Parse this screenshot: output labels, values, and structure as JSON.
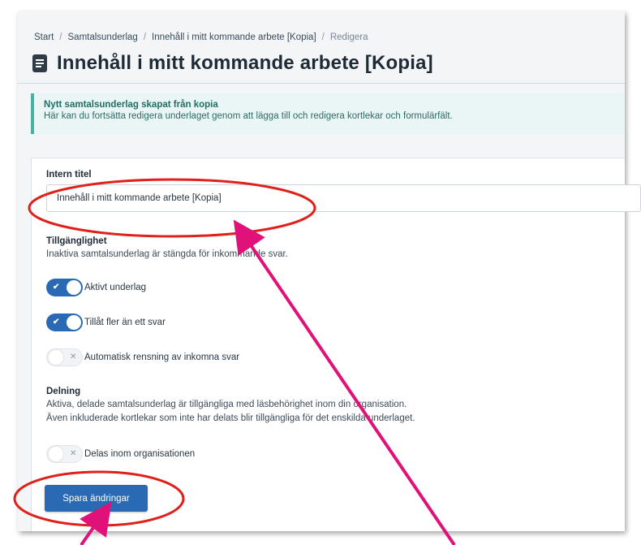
{
  "breadcrumb": {
    "items": [
      "Start",
      "Samtalsunderlag",
      "Innehåll i mitt kommande arbete [Kopia]",
      "Redigera"
    ],
    "separator": "/"
  },
  "header": {
    "icon": "document-icon",
    "title": "Innehåll i mitt kommande arbete [Kopia]"
  },
  "alert": {
    "title": "Nytt samtalsunderlag skapat från kopia",
    "text": "Här kan du fortsätta redigera underlaget genom att lägga till och redigera kortlekar och formulärfält.",
    "accent": "#43b3a6"
  },
  "form": {
    "internal_title_label": "Intern titel",
    "internal_title_value": "Innehåll i mitt kommande arbete [Kopia]",
    "availability": {
      "heading": "Tillgänglighet",
      "description": "Inaktiva samtalsunderlag är stängda för inkommande svar.",
      "toggles": [
        {
          "label": "Aktivt underlag",
          "checked": true
        },
        {
          "label": "Tillåt fler än ett svar",
          "checked": true
        },
        {
          "label": "Automatisk rensning av inkomna svar",
          "checked": false
        }
      ]
    },
    "sharing": {
      "heading": "Delning",
      "description_line1": "Aktiva, delade samtalsunderlag är tillgängliga med läsbehörighet inom din organisation.",
      "description_line2": "Även inkluderade kortlekar som inte har delats blir tillgängliga för det enskilda underlaget.",
      "toggles": [
        {
          "label": "Delas inom organisationen",
          "checked": false
        }
      ]
    },
    "save_label": "Spara ändringar"
  },
  "colors": {
    "primary": "#2a6ab5",
    "annotation_ellipse": "#e0201b",
    "annotation_arrow": "#e0127a"
  }
}
